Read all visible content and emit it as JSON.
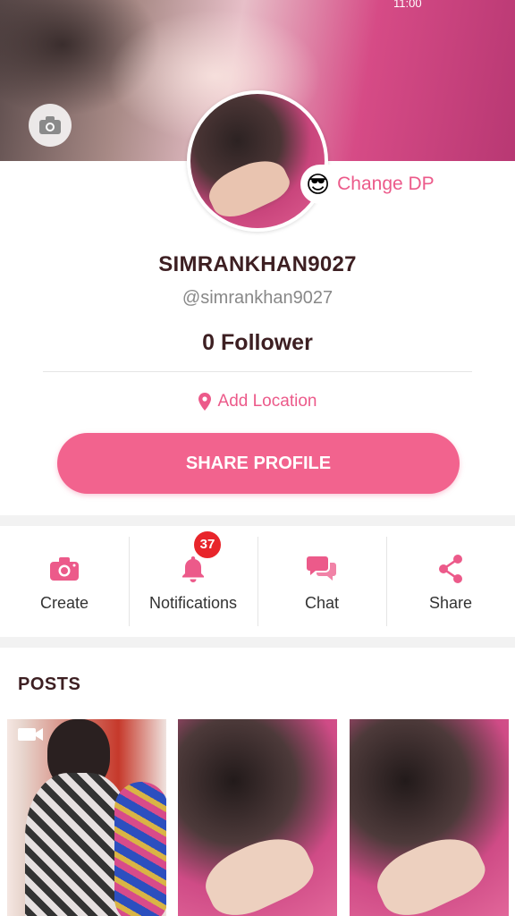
{
  "status": {
    "time": "11:00"
  },
  "profile": {
    "change_dp_emoji": "😎",
    "change_dp_label": "Change DP",
    "username": "SIMRANKHAN9027",
    "handle": "@simrankhan9027",
    "followers": "0 Follower",
    "location_label": "Add Location",
    "share_label": "SHARE PROFILE"
  },
  "actions": [
    {
      "label": "Create",
      "icon": "camera-icon"
    },
    {
      "label": "Notifications",
      "icon": "bell-icon",
      "badge": "37"
    },
    {
      "label": "Chat",
      "icon": "chat-icon"
    },
    {
      "label": "Share",
      "icon": "share-icon"
    }
  ],
  "posts": {
    "title": "POSTS",
    "count": 3
  },
  "colors": {
    "accent": "#f2638e",
    "text_dark": "#3d1f22",
    "badge": "#e8252b"
  }
}
